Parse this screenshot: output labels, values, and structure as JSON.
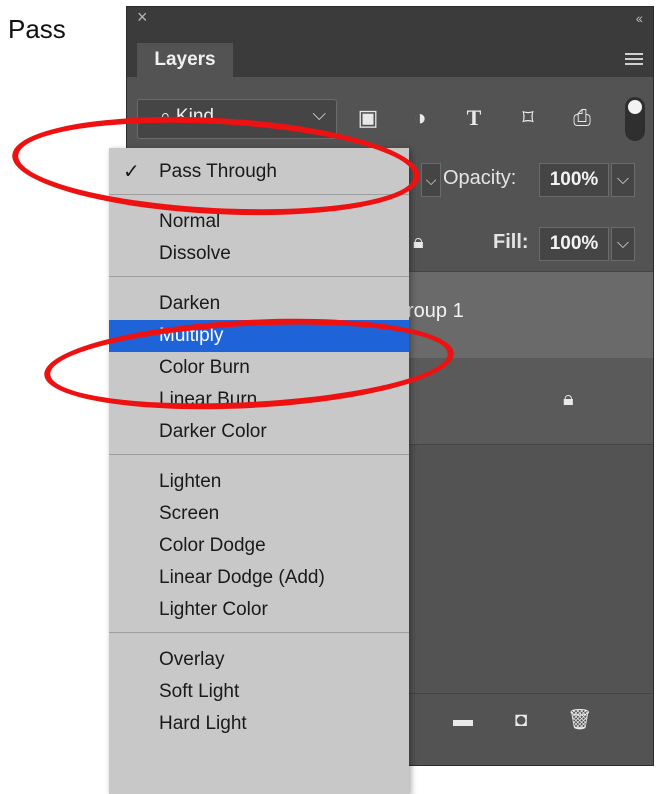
{
  "caption": "Pass",
  "panel": {
    "tab": "Layers",
    "filter_kind": "Kind",
    "opacity_label": "Opacity:",
    "opacity_value": "100%",
    "fill_label": "Fill:",
    "fill_value": "100%",
    "layers": [
      {
        "name": "roup 1"
      }
    ]
  },
  "blend_menu": {
    "groups": [
      [
        {
          "label": "Pass Through",
          "checked": true
        }
      ],
      [
        {
          "label": "Normal"
        },
        {
          "label": "Dissolve"
        }
      ],
      [
        {
          "label": "Darken"
        },
        {
          "label": "Multiply",
          "selected": true
        },
        {
          "label": "Color Burn"
        },
        {
          "label": "Linear Burn"
        },
        {
          "label": "Darker Color"
        }
      ],
      [
        {
          "label": "Lighten"
        },
        {
          "label": "Screen"
        },
        {
          "label": "Color Dodge"
        },
        {
          "label": "Linear Dodge (Add)"
        },
        {
          "label": "Lighter Color"
        }
      ],
      [
        {
          "label": "Overlay"
        },
        {
          "label": "Soft Light"
        },
        {
          "label": "Hard Light"
        }
      ]
    ],
    "checkmark": "✓"
  },
  "colors": {
    "panel_bg": "#535353",
    "menu_bg": "#c8c8c8",
    "highlight": "#1e64d8",
    "annotation": "#ee1111"
  }
}
